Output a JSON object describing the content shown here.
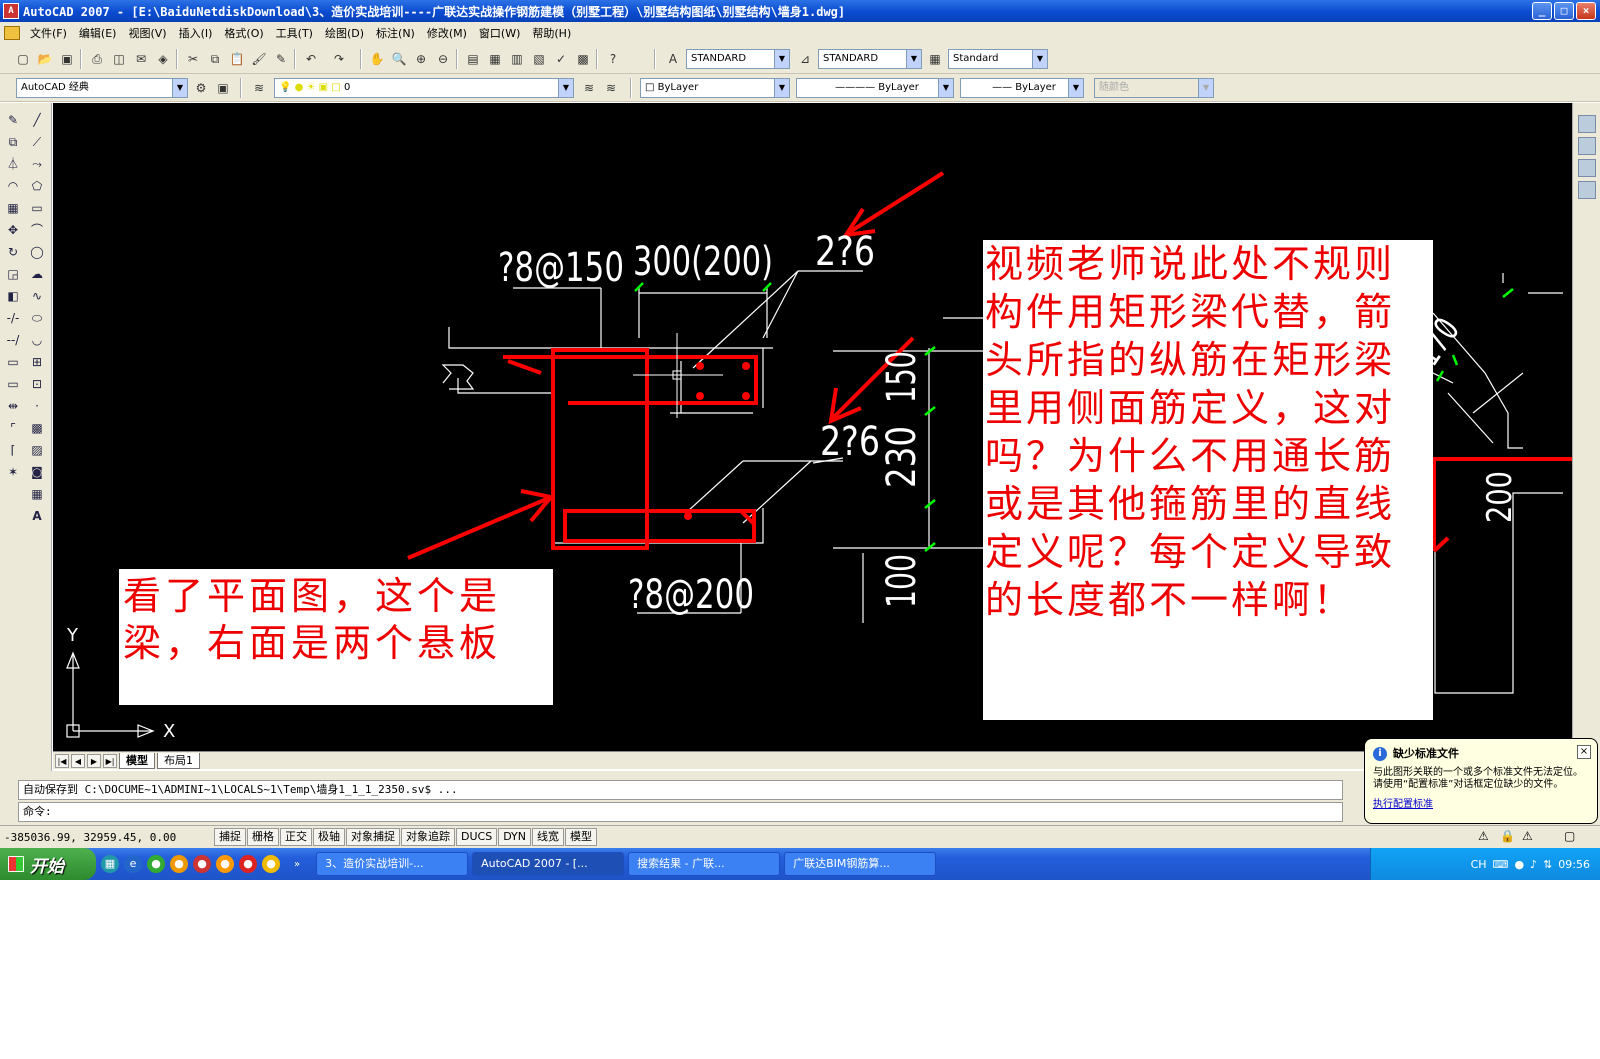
{
  "window": {
    "title": "AutoCAD 2007 - [E:\\BaiduNetdiskDownload\\3、造价实战培训----广联达实战操作钢筋建模（别墅工程）\\别墅结构图纸\\别墅结构\\墙身1.dwg]",
    "minimize": "_",
    "restore": "□",
    "close": "×"
  },
  "menu": {
    "items": [
      "文件(F)",
      "编辑(E)",
      "视图(V)",
      "插入(I)",
      "格式(O)",
      "工具(T)",
      "绘图(D)",
      "标注(N)",
      "修改(M)",
      "窗口(W)",
      "帮助(H)"
    ],
    "doc_controls": [
      "_",
      "□",
      "×"
    ]
  },
  "toolbar1": {
    "text_style": "STANDARD",
    "dim_style": "STANDARD",
    "table_style": "Standard"
  },
  "toolbar2": {
    "workspace": "AutoCAD 经典",
    "layer": "0",
    "color": "ByLayer",
    "linetype": "ByLayer",
    "lineweight": "ByLayer",
    "plotstyle": "随颜色"
  },
  "drawing": {
    "label_stirrup_top": "?8@150",
    "label_dim_top": "300(200)",
    "label_bar_1": "2?6",
    "label_bar_2": "2?6",
    "label_stirrup_bottom": "?8@200",
    "dim_150": "150",
    "dim_230": "230",
    "dim_100": "100",
    "dim_170": "170",
    "dim_200": "200",
    "axis_y": "Y",
    "axis_x": "X"
  },
  "notes": {
    "note1": "看了平面图，这个是梁，右面是两个悬板",
    "note2": "视频老师说此处不规则构件用矩形梁代替，箭头所指的纵筋在矩形梁里用侧面筋定义，这对吗？为什么不用通长筋或是其他箍筋里的直线定义呢？每个定义导致的长度都不一样啊！"
  },
  "layout_tabs": [
    "模型",
    "布局1"
  ],
  "command": {
    "history": "自动保存到 C:\\DOCUME~1\\ADMINI~1\\LOCALS~1\\Temp\\墙身1_1_1_2350.sv$ ...",
    "prompt": "命令:"
  },
  "status": {
    "coords": "-385036.99, 32959.45, 0.00",
    "toggles": [
      "捕捉",
      "栅格",
      "正交",
      "极轴",
      "对象捕捉",
      "对象追踪",
      "DUCS",
      "DYN",
      "线宽",
      "模型"
    ]
  },
  "balloon": {
    "title": "缺少标准文件",
    "body": "与此图形关联的一个或多个标准文件无法定位。请使用“配置标准”对话框定位缺少的文件。",
    "link": "执行配置标准",
    "close": "×"
  },
  "taskbar": {
    "start": "开始",
    "tasks": [
      "3、造价实战培训-...",
      "AutoCAD 2007 - [...",
      "搜索结果 - 广联...",
      "广联达BIM钢筋算..."
    ],
    "tray_lang": "CH",
    "clock": "09:56"
  },
  "colors": {
    "title_blue": "#0a4bd0",
    "canvas_bg": "#000000",
    "annotation_red": "#ff0000",
    "cad_green": "#00ff00"
  }
}
